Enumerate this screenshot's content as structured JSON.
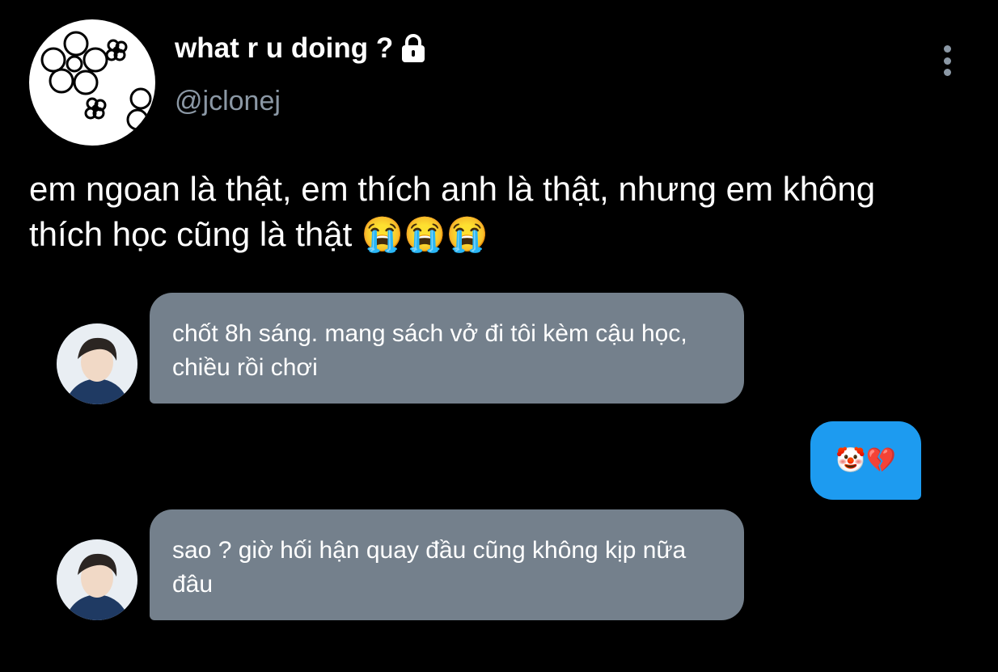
{
  "tweet": {
    "display_name": "what r u doing ?",
    "handle": "@jclonej",
    "text": "em ngoan là thật, em thích anh là thật, nhưng em không thích học cũng là thật 😭😭😭"
  },
  "chat": {
    "messages": [
      {
        "direction": "incoming",
        "text": "chốt 8h sáng. mang sách vở đi tôi kèm cậu học, chiều rồi chơi"
      },
      {
        "direction": "outgoing",
        "text": "🤡💔"
      },
      {
        "direction": "incoming",
        "text": "sao ? giờ hối hận quay đầu cũng không kịp nữa đâu"
      }
    ]
  },
  "colors": {
    "background": "#000000",
    "handle_text": "#8b98a5",
    "incoming_bubble": "#74808c",
    "outgoing_bubble": "#1d9bf0"
  },
  "icons": {
    "lock": "lock-icon",
    "more": "more-vertical-icon"
  }
}
